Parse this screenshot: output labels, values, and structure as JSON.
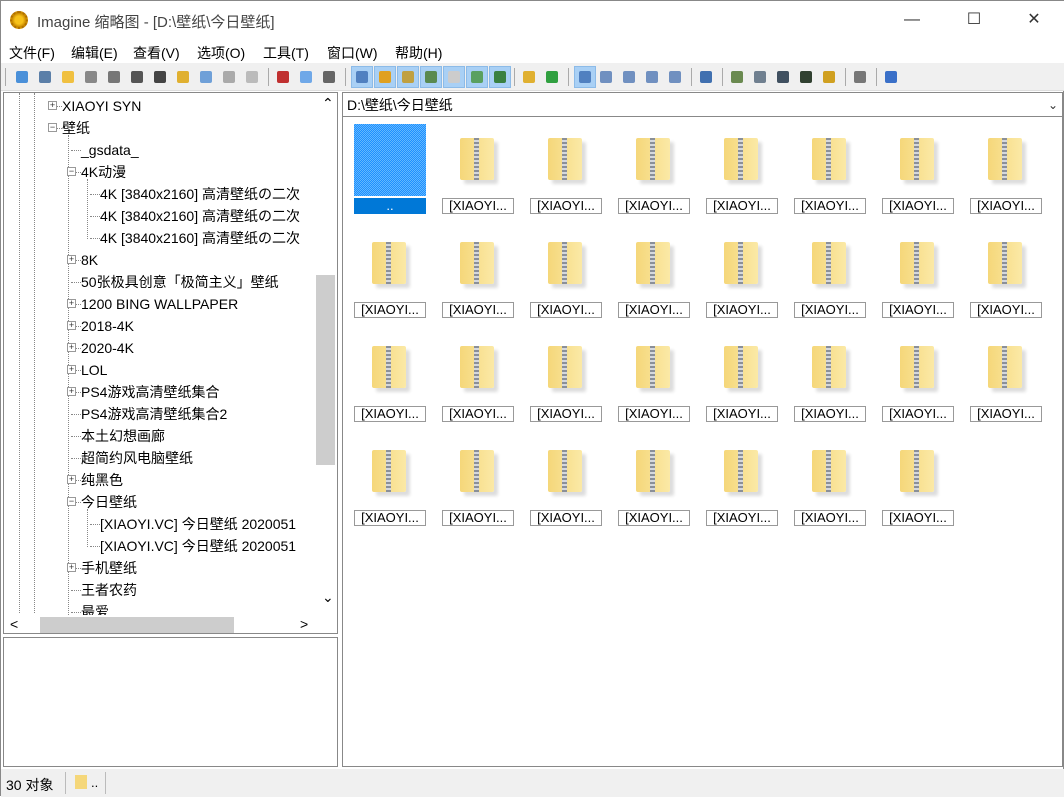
{
  "window": {
    "title": "Imagine 缩略图 - [D:\\壁纸\\今日壁纸]",
    "minimize": "—",
    "maximize": "☐",
    "close": "✕"
  },
  "menu": [
    "文件(F)",
    "编辑(E)",
    "查看(V)",
    "选项(O)",
    "工具(T)",
    "窗口(W)",
    "帮助(H)"
  ],
  "toolbar": [
    {
      "icon": "view-eye-icon",
      "color": "#4a90d9"
    },
    {
      "icon": "slideshow-icon",
      "color": "#5b7fa8"
    },
    {
      "icon": "open-folder-icon",
      "color": "#f0c040"
    },
    {
      "icon": "save-icon",
      "color": "#888"
    },
    {
      "icon": "print-icon",
      "color": "#777"
    },
    {
      "icon": "info-icon",
      "color": "#555"
    },
    {
      "icon": "camera-info-icon",
      "color": "#444"
    },
    {
      "icon": "new-folder-icon",
      "color": "#e0b030"
    },
    {
      "icon": "rename-icon",
      "color": "#6fa0d8"
    },
    {
      "icon": "delete-icon",
      "color": "#aaa"
    },
    {
      "icon": "properties-icon",
      "color": "#bbb"
    },
    "sep",
    {
      "icon": "cut-icon",
      "color": "#c03030"
    },
    {
      "icon": "copy-icon",
      "color": "#6fa8e8"
    },
    {
      "icon": "paste-icon",
      "color": "#666"
    },
    "sep",
    {
      "icon": "show-toolbar-icon",
      "color": "#5080c0",
      "on": true
    },
    {
      "icon": "show-tree-icon",
      "color": "#e0a020",
      "on": true
    },
    {
      "icon": "show-info-icon",
      "color": "#c0a040",
      "on": true
    },
    {
      "icon": "show-preview-icon",
      "color": "#5a8a50",
      "on": true
    },
    {
      "icon": "show-grid-icon",
      "color": "#ccc",
      "on": true
    },
    {
      "icon": "show-thumbnail-icon",
      "color": "#5aa060",
      "on": true
    },
    {
      "icon": "show-statusbar-icon",
      "color": "#3a8040",
      "on": true
    },
    "sep",
    {
      "icon": "up-folder-icon",
      "color": "#e0b030"
    },
    {
      "icon": "refresh-icon",
      "color": "#30a040"
    },
    "sep",
    {
      "icon": "thumbnails-view-icon",
      "color": "#5080c0",
      "on": true
    },
    {
      "icon": "large-icons-view-icon",
      "color": "#7090c0"
    },
    {
      "icon": "small-icons-view-icon",
      "color": "#7090c0"
    },
    {
      "icon": "list-view-icon",
      "color": "#7090c0"
    },
    {
      "icon": "details-view-icon",
      "color": "#7090c0"
    },
    "sep",
    {
      "icon": "wrench-icon",
      "color": "#4070b0"
    },
    "sep",
    {
      "icon": "batch-convert-icon",
      "color": "#6a8a50"
    },
    {
      "icon": "batch-rename-icon",
      "color": "#708090"
    },
    {
      "icon": "screen-capture-icon",
      "color": "#405060"
    },
    {
      "icon": "filmstrip-icon",
      "color": "#304030"
    },
    {
      "icon": "edit-tags-icon",
      "color": "#d0a020"
    },
    "sep",
    {
      "icon": "options-icon",
      "color": "#777"
    },
    "sep",
    {
      "icon": "help-icon",
      "color": "#3a70c8"
    }
  ],
  "tree": [
    {
      "label": "XIAOYI SYN",
      "level": 1,
      "exp": "+"
    },
    {
      "label": "壁纸",
      "level": 1,
      "exp": "−"
    },
    {
      "label": "_gsdata_",
      "level": 2
    },
    {
      "label": "4K动漫",
      "level": 2,
      "exp": "−"
    },
    {
      "label": "4K [3840x2160] 高清壁纸の二次",
      "level": 3
    },
    {
      "label": "4K [3840x2160] 高清壁纸の二次",
      "level": 3
    },
    {
      "label": "4K [3840x2160] 高清壁纸の二次",
      "level": 3
    },
    {
      "label": "8K",
      "level": 2,
      "exp": "+"
    },
    {
      "label": "50张极具创意「极简主义」壁纸",
      "level": 2
    },
    {
      "label": "1200 BING WALLPAPER",
      "level": 2,
      "exp": "+"
    },
    {
      "label": "2018-4K",
      "level": 2,
      "exp": "+"
    },
    {
      "label": "2020-4K",
      "level": 2,
      "exp": "+"
    },
    {
      "label": "LOL",
      "level": 2,
      "exp": "+"
    },
    {
      "label": "PS4游戏高清壁纸集合",
      "level": 2,
      "exp": "+"
    },
    {
      "label": "PS4游戏高清壁纸集合2",
      "level": 2
    },
    {
      "label": "本土幻想画廊",
      "level": 2
    },
    {
      "label": "超简约风电脑壁纸",
      "level": 2
    },
    {
      "label": "纯黑色",
      "level": 2,
      "exp": "+"
    },
    {
      "label": "今日壁纸",
      "level": 2,
      "exp": "−"
    },
    {
      "label": "[XIAOYI.VC] 今日壁纸 2020051",
      "level": 3
    },
    {
      "label": "[XIAOYI.VC] 今日壁纸 2020051",
      "level": 3
    },
    {
      "label": "手机壁纸",
      "level": 2,
      "exp": "+"
    },
    {
      "label": "王者农药",
      "level": 2
    },
    {
      "label": "最爱",
      "level": 2
    }
  ],
  "scroll": {
    "up": "⌃",
    "down": "⌄",
    "left": "<",
    "right": ">"
  },
  "path": {
    "value": "D:\\壁纸\\今日壁纸",
    "dropdown": "⌄"
  },
  "items": [
    "..",
    "[XIAOYI...",
    "[XIAOYI...",
    "[XIAOYI...",
    "[XIAOYI...",
    "[XIAOYI...",
    "[XIAOYI...",
    "[XIAOYI...",
    "[XIAOYI...",
    "[XIAOYI...",
    "[XIAOYI...",
    "[XIAOYI...",
    "[XIAOYI...",
    "[XIAOYI...",
    "[XIAOYI...",
    "[XIAOYI...",
    "[XIAOYI...",
    "[XIAOYI...",
    "[XIAOYI...",
    "[XIAOYI...",
    "[XIAOYI...",
    "[XIAOYI...",
    "[XIAOYI...",
    "[XIAOYI...",
    "[XIAOYI...",
    "[XIAOYI...",
    "[XIAOYI...",
    "[XIAOYI...",
    "[XIAOYI...",
    "[XIAOYI...",
    "[XIAOYI..."
  ],
  "status": {
    "count": "30 对象",
    "path": ".."
  }
}
